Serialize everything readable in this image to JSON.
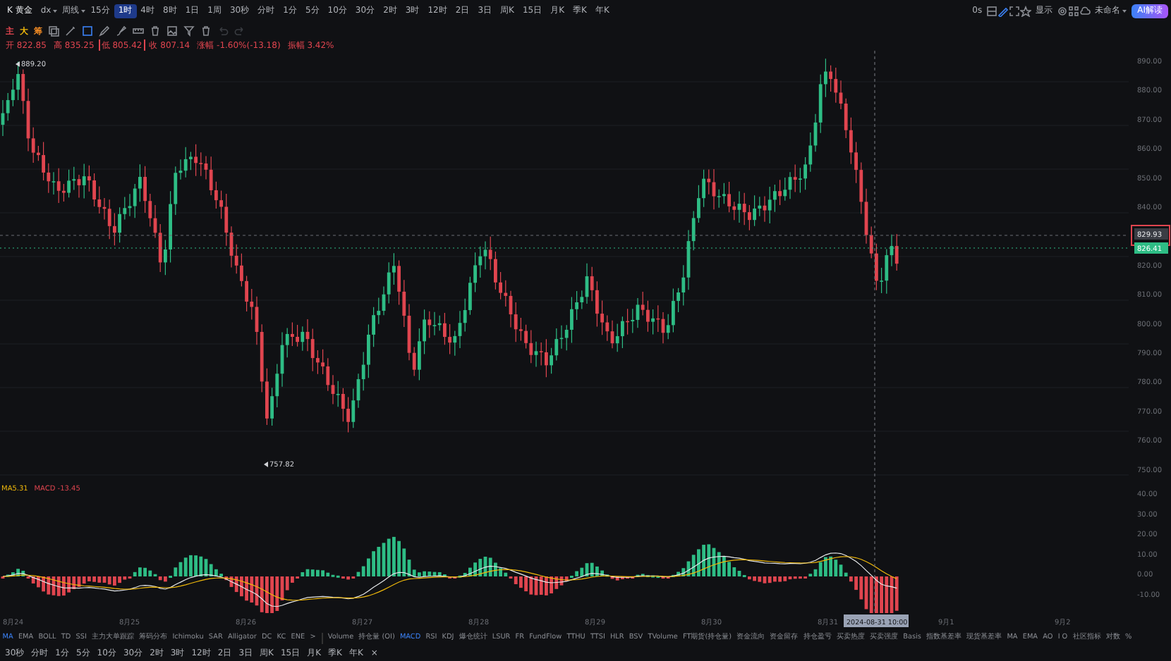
{
  "top_bar": {
    "symbol": "K 黄金",
    "menus": [
      "dx",
      "周线"
    ],
    "intervals": [
      {
        "label": "15分",
        "selected": false
      },
      {
        "label": "1时",
        "selected": true
      },
      {
        "label": "4时",
        "selected": false
      },
      {
        "label": "8时",
        "selected": false
      },
      {
        "label": "1日",
        "selected": false
      },
      {
        "label": "1周",
        "selected": false
      },
      {
        "label": "30秒",
        "selected": false
      },
      {
        "label": "分时",
        "selected": false
      },
      {
        "label": "1分",
        "selected": false
      },
      {
        "label": "5分",
        "selected": false
      },
      {
        "label": "10分",
        "selected": false
      },
      {
        "label": "30分",
        "selected": false
      },
      {
        "label": "2时",
        "selected": false
      },
      {
        "label": "3时",
        "selected": false
      },
      {
        "label": "12时",
        "selected": false
      },
      {
        "label": "2日",
        "selected": false
      },
      {
        "label": "3日",
        "selected": false
      },
      {
        "label": "周K",
        "selected": false
      },
      {
        "label": "15日",
        "selected": false
      },
      {
        "label": "月K",
        "selected": false
      },
      {
        "label": "季K",
        "selected": false
      },
      {
        "label": "年K",
        "selected": false
      }
    ],
    "latency": "0s",
    "display_label": "显示",
    "layout_name": "未命名",
    "ai_button": "AI解读"
  },
  "toolbar": {
    "toggles": [
      {
        "label": "主",
        "color": "#e0454f"
      },
      {
        "label": "大",
        "color": "#f0b90b"
      },
      {
        "label": "筹",
        "color": "#f08a24"
      }
    ]
  },
  "ohlc": [
    {
      "label": "开",
      "value": "822.85",
      "highlighted": false
    },
    {
      "label": "高",
      "value": "835.25",
      "highlighted": false
    },
    {
      "label": "低",
      "value": "805.42",
      "highlighted": true
    },
    {
      "label": "收",
      "value": "807.14",
      "highlighted": false
    },
    {
      "label": "涨幅",
      "value": "-1.60%(-13.18)",
      "highlighted": false
    },
    {
      "label": "振幅",
      "value": "3.42%",
      "highlighted": false
    }
  ],
  "price_chart": {
    "max_label": "889.20",
    "min_label": "757.82",
    "axis_labels": [
      "890.00",
      "880.00",
      "870.00",
      "860.00",
      "850.00",
      "840.00",
      "820.00",
      "810.00",
      "800.00",
      "790.00",
      "780.00",
      "770.00",
      "760.00",
      "750.00"
    ],
    "price_tag": "829.93",
    "last_price_tag": "826.41"
  },
  "macd": {
    "legend": [
      {
        "text": "MA5.31",
        "color": "#f0b90b"
      },
      {
        "text": "MACD -13.45",
        "color": "#e0454f"
      }
    ],
    "axis_labels": [
      "40.00",
      "30.00",
      "20.00",
      "10.00",
      "0.00",
      "-10.00"
    ]
  },
  "x_axis": {
    "labels": [
      "8月24",
      "8月25",
      "8月26",
      "8月27",
      "8月28",
      "8月29",
      "8月30",
      "8月31",
      "9月1",
      "9月2"
    ],
    "crosshair_label": "2024-08-31 10:00"
  },
  "main_indicators": [
    {
      "label": "MA",
      "selected": true
    },
    {
      "label": "EMA",
      "selected": false
    },
    {
      "label": "BOLL",
      "selected": false
    },
    {
      "label": "TD",
      "selected": false
    },
    {
      "label": "SSI",
      "selected": false
    },
    {
      "label": "主力大单跟踪",
      "selected": false
    },
    {
      "label": "筹码分布",
      "selected": false
    },
    {
      "label": "Ichimoku",
      "selected": false
    },
    {
      "label": "SAR",
      "selected": false
    },
    {
      "label": "Alligator",
      "selected": false
    },
    {
      "label": "DC",
      "selected": false
    },
    {
      "label": "KC",
      "selected": false
    },
    {
      "label": "ENE",
      "selected": false
    }
  ],
  "more": ">",
  "sub_indicators": [
    {
      "label": "Volume",
      "selected": false
    },
    {
      "label": "持仓量 (OI)",
      "selected": false
    },
    {
      "label": "MACD",
      "selected": true
    },
    {
      "label": "RSI",
      "selected": false
    },
    {
      "label": "KDJ",
      "selected": false
    },
    {
      "label": "爆仓统计",
      "selected": false
    },
    {
      "label": "LSUR",
      "selected": false
    },
    {
      "label": "FR",
      "selected": false
    },
    {
      "label": "FundFlow",
      "selected": false
    },
    {
      "label": "TTHU",
      "selected": false
    },
    {
      "label": "TTSI",
      "selected": false
    },
    {
      "label": "HLR",
      "selected": false
    },
    {
      "label": "BSV",
      "selected": false
    },
    {
      "label": "TVolume",
      "selected": false
    },
    {
      "label": "FT期货(持仓量)",
      "selected": false
    },
    {
      "label": "资金流向",
      "selected": false
    },
    {
      "label": "资金留存",
      "selected": false
    },
    {
      "label": "持仓盈亏",
      "selected": false
    },
    {
      "label": "买卖热度",
      "selected": false
    },
    {
      "label": "买卖强度",
      "selected": false
    },
    {
      "label": "Basis",
      "selected": false
    },
    {
      "label": "指数基差率",
      "selected": false
    },
    {
      "label": "现货基差率",
      "selected": false
    },
    {
      "label": "MA",
      "selected": false
    },
    {
      "label": "EMA",
      "selected": false
    },
    {
      "label": "AO",
      "selected": false
    },
    {
      "label": "I O",
      "selected": false
    },
    {
      "label": "社区指标",
      "selected": false
    }
  ],
  "scale_options": [
    "对数",
    "%"
  ],
  "bottom_intervals": [
    "30秒",
    "分时",
    "1分",
    "5分",
    "10分",
    "30分",
    "2时",
    "3时",
    "12时",
    "2日",
    "3日",
    "周K",
    "15日",
    "月K",
    "季K",
    "年K"
  ],
  "close": "×"
}
